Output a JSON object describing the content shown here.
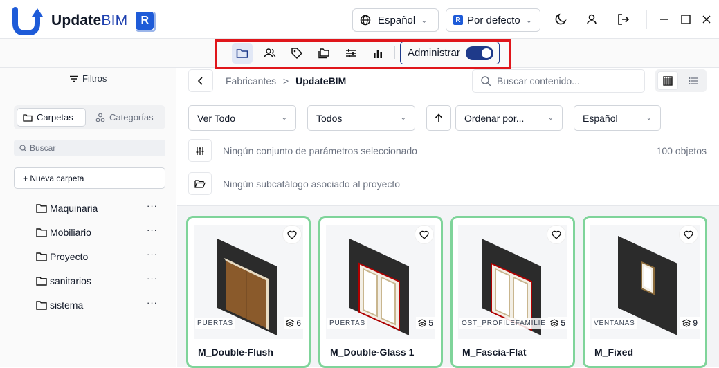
{
  "app": {
    "name_bold": "Update",
    "name_light": "BIM",
    "badge": "R"
  },
  "header": {
    "language": "Español",
    "profile": "Por defecto",
    "profile_badge": "R"
  },
  "toolbar": {
    "icons": [
      "folder-icon",
      "users-icon",
      "tag-icon",
      "folders-icon",
      "sliders-icon",
      "bar-chart-icon"
    ],
    "admin_label": "Administrar",
    "admin_enabled": true
  },
  "sidebar": {
    "filters_label": "Filtros",
    "tabs": [
      {
        "label": "Carpetas"
      },
      {
        "label": "Categorías"
      }
    ],
    "search_placeholder": "Buscar",
    "new_folder": "+ Nueva carpeta",
    "folders": [
      {
        "label": "Maquinaria",
        "more": "···"
      },
      {
        "label": "Mobiliario",
        "more": "···"
      },
      {
        "label": "Proyecto",
        "more": "···"
      },
      {
        "label": "sanitarios",
        "more": "···"
      },
      {
        "label": "sistema",
        "more": "···"
      }
    ]
  },
  "main": {
    "breadcrumb": {
      "parent": "Fabricantes",
      "separator": ">",
      "current": "UpdateBIM"
    },
    "search_placeholder": "Buscar contenido...",
    "filters": {
      "view": "Ver Todo",
      "type": "Todos",
      "sort": "Ordenar por...",
      "language": "Español"
    },
    "params_text": "Ningún conjunto de parámetros seleccionado",
    "object_count": "100 objetos",
    "subcatalog_text": "Ningún subcatálogo asociado al proyecto",
    "cards": [
      {
        "category": "PUERTAS",
        "count": "6",
        "name": "M_Double-Flush"
      },
      {
        "category": "PUERTAS",
        "count": "5",
        "name": "M_Double-Glass 1"
      },
      {
        "category": "OST_PROFILEFAMILIE",
        "count": "5",
        "name": "M_Fascia-Flat"
      },
      {
        "category": "VENTANAS",
        "count": "9",
        "name": "M_Fixed"
      }
    ]
  },
  "colors": {
    "brand": "#1e40af",
    "accent_green": "#7fd49a",
    "highlight_red": "#e0161b"
  }
}
